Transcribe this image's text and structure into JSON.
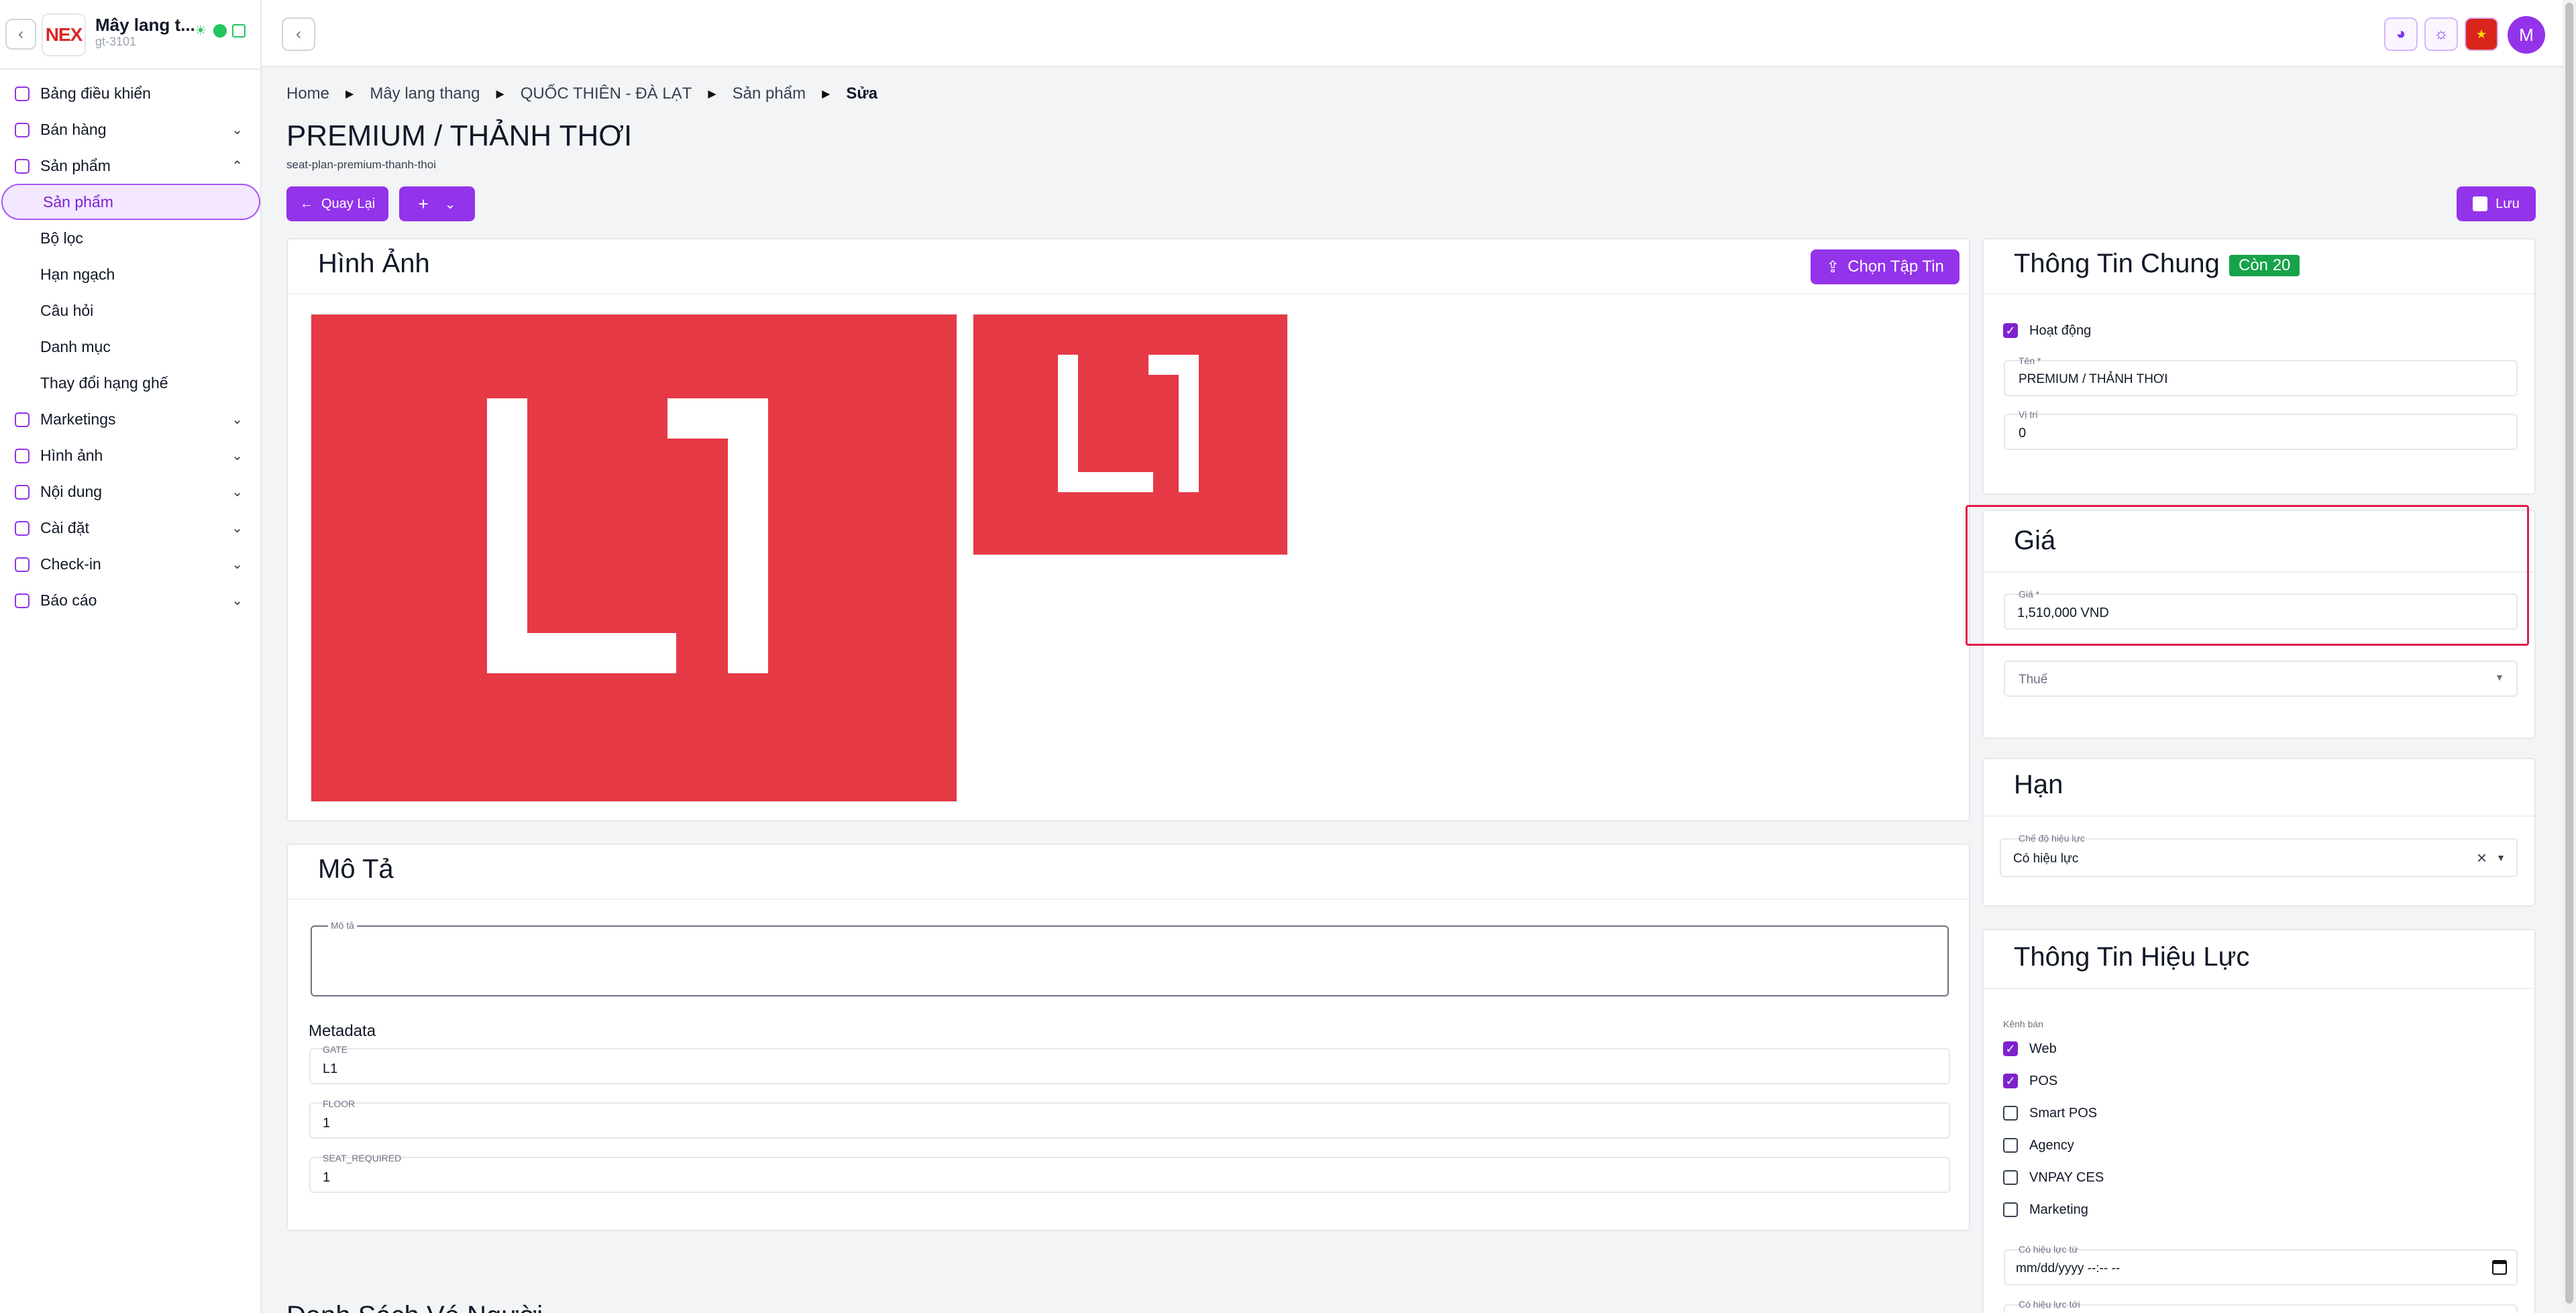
{
  "sidebar": {
    "org_name": "Mây lang t...",
    "org_id": "gt-3101",
    "logo_text": "NEX",
    "items": [
      {
        "label": "Bảng điều khiển"
      },
      {
        "label": "Bán hàng"
      },
      {
        "label": "Sản phẩm"
      },
      {
        "label": "Sản phẩm"
      },
      {
        "label": "Bộ lọc"
      },
      {
        "label": "Hạn ngạch"
      },
      {
        "label": "Câu hỏi"
      },
      {
        "label": "Danh mục"
      },
      {
        "label": "Thay đổi hạng ghế"
      },
      {
        "label": "Marketings"
      },
      {
        "label": "Hình ảnh"
      },
      {
        "label": "Nội dung"
      },
      {
        "label": "Cài đặt"
      },
      {
        "label": "Check-in"
      },
      {
        "label": "Báo cáo"
      }
    ]
  },
  "topbar": {
    "avatar_initial": "M",
    "icons": [
      "palette-icon",
      "theme-icon",
      "vietnam-flag-icon"
    ]
  },
  "breadcrumb": [
    "Home",
    "Mây lang thang",
    "QUỐC THIÊN - ĐÀ LẠT",
    "Sản phẩm",
    "Sửa"
  ],
  "page": {
    "title": "PREMIUM / THẢNH THƠI",
    "slug": "seat-plan-premium-thanh-thoi",
    "back_label": "Quay Lại",
    "add_label": "+",
    "save_label": "Lưu"
  },
  "images_card": {
    "title": "Hình Ảnh",
    "upload_label": "Chọn Tập Tin",
    "image_text": "L1"
  },
  "description_card": {
    "title": "Mô Tả",
    "field_label": "Mô tả",
    "metadata_title": "Metadata",
    "metadata": [
      {
        "key": "GATE",
        "value": "L1"
      },
      {
        "key": "FLOOR",
        "value": "1"
      },
      {
        "key": "SEAT_REQUIRED",
        "value": "1"
      }
    ]
  },
  "general_card": {
    "title": "Thông Tin Chung",
    "badge": "Còn 20",
    "active_label": "Hoạt động",
    "name_label": "Tên *",
    "name_value": "PREMIUM / THẢNH THƠI",
    "position_label": "Vị trí",
    "position_value": "0"
  },
  "price_card": {
    "title": "Giá",
    "price_label": "Giá *",
    "price_value": "1,510,000 VND",
    "tax_placeholder": "Thuế"
  },
  "term_card": {
    "title": "Hạn",
    "mode_label": "Chế độ hiệu lực",
    "mode_value": "Có hiệu lực"
  },
  "validity_card": {
    "title": "Thông Tin Hiệu Lực",
    "channels_label": "Kênh bán",
    "channels": [
      {
        "label": "Web",
        "checked": true
      },
      {
        "label": "POS",
        "checked": true
      },
      {
        "label": "Smart POS",
        "checked": false
      },
      {
        "label": "Agency",
        "checked": false
      },
      {
        "label": "VNPAY CES",
        "checked": false
      },
      {
        "label": "Marketing",
        "checked": false
      }
    ],
    "valid_from_label": "Có hiệu lực từ",
    "valid_from_value": "mm/dd/yyyy --:-- --",
    "valid_to_label": "Có hiệu lực tới"
  },
  "next_section_title": "Danh Sách Vé Người"
}
